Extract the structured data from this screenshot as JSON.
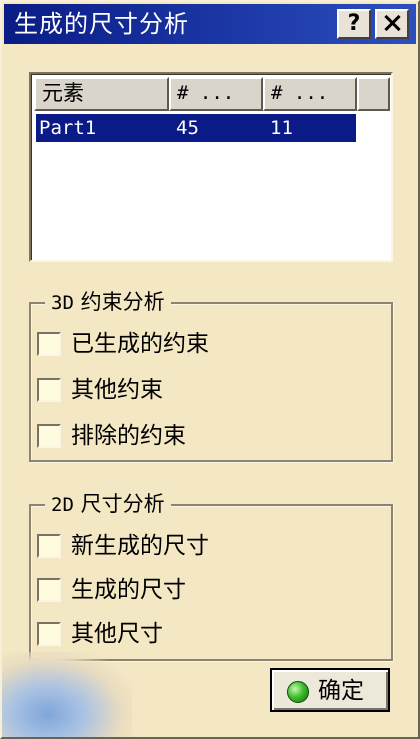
{
  "window": {
    "title": "生成的尺寸分析",
    "help_label": "?",
    "close_icon": "close-icon"
  },
  "list": {
    "columns": [
      "元素",
      "# ...",
      "# ...",
      ""
    ],
    "rows": [
      {
        "cells": [
          "Part1",
          "45",
          "11"
        ],
        "selected": true
      }
    ]
  },
  "group_3d": {
    "legend_num": "3D",
    "legend_text": "约束分析",
    "options": [
      {
        "label": "已生成的约束",
        "checked": false
      },
      {
        "label": "其他约束",
        "checked": false
      },
      {
        "label": "排除的约束",
        "checked": false
      }
    ]
  },
  "group_2d": {
    "legend_num": "2D",
    "legend_text": "尺寸分析",
    "options": [
      {
        "label": "新生成的尺寸",
        "checked": false
      },
      {
        "label": "生成的尺寸",
        "checked": false
      },
      {
        "label": "其他尺寸",
        "checked": false
      }
    ]
  },
  "ok_button": {
    "label": "确定",
    "icon": "green-ball-icon"
  },
  "colors": {
    "title_bar": "#0a1c86",
    "selection": "#0a1a86",
    "background": "#f3e7c4"
  }
}
